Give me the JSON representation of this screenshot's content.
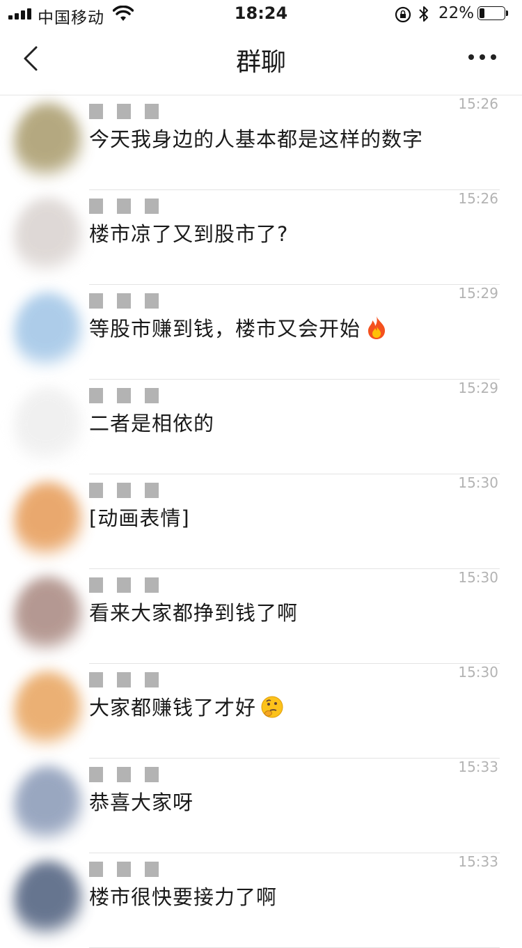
{
  "status_bar": {
    "carrier": "中国移动",
    "time": "18:24",
    "battery_percent": "22%",
    "battery_level": 0.22
  },
  "nav": {
    "title": "群聊",
    "back_icon": "chevron-left-icon",
    "more_icon": "ellipsis-icon"
  },
  "messages": [
    {
      "time": "15:26",
      "text": "今天我身边的人基本都是这样的数字",
      "avatar_color": "#a89a6a"
    },
    {
      "time": "15:26",
      "text": "楼市凉了又到股市了?",
      "avatar_color": "#d9d2cf"
    },
    {
      "time": "15:29",
      "text": "等股市赚到钱，楼市又会开始",
      "emoji": "fire-emoji",
      "avatar_color": "#9fc4e6"
    },
    {
      "time": "15:29",
      "text": "二者是相依的",
      "avatar_color": "#eeeeee"
    },
    {
      "time": "15:30",
      "text": "[动画表情]",
      "avatar_color": "#e69a55"
    },
    {
      "time": "15:30",
      "text": "看来大家都挣到钱了啊",
      "avatar_color": "#a8877f"
    },
    {
      "time": "15:30",
      "text": "大家都赚钱了才好",
      "emoji": "thinking-face-emoji",
      "avatar_color": "#e8a35c"
    },
    {
      "time": "15:33",
      "text": "恭喜大家呀",
      "avatar_color": "#8898b6"
    },
    {
      "time": "15:33",
      "text": "楼市很快要接力了啊",
      "avatar_color": "#4c5d7c"
    }
  ]
}
